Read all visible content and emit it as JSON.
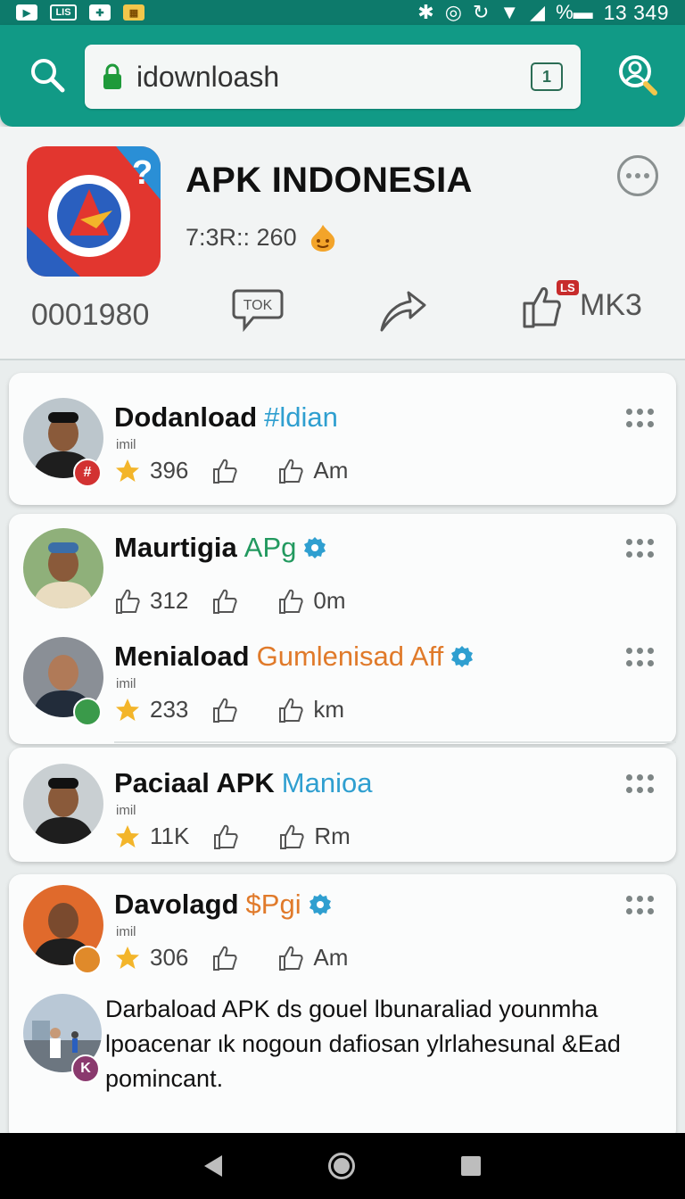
{
  "status_bar": {
    "left_icons": [
      "play-icon",
      "lis-icon",
      "app-icon",
      "store-icon"
    ],
    "lis_label": "LIS",
    "battery_label": "%",
    "time": "13 349"
  },
  "url_bar": {
    "url": "idownloash",
    "tab_count": "1"
  },
  "header": {
    "title": "APK INDONESIA",
    "subtitle": "7:3R:: 260",
    "downloads": "0001980",
    "chat_label": "TOK",
    "like_badge": "LS",
    "like_count": "MK3"
  },
  "items": [
    {
      "name": "Dodanload",
      "accent": "#ldian",
      "accent_color": "#2f9fd0",
      "handle": "imil",
      "first_icon": "star-icon",
      "v1": "396",
      "v2": "Am",
      "badge_color": "#d23232",
      "badge_text": "#"
    },
    {
      "name": "Maurtigia",
      "accent": "APg",
      "accent_color": "#22995f",
      "handle": "",
      "first_icon": "thumbs-up-icon",
      "v1": "312",
      "v2": "0m",
      "verified": true
    },
    {
      "name": "Meniaload",
      "accent": "Gumlenisad Aff",
      "accent_color": "#e07a2a",
      "accent2_color": "#2f7fc0",
      "handle": "imil",
      "first_icon": "star-icon",
      "v1": "233",
      "v2": "km",
      "verified": true,
      "badge_color": "#3a9a4a",
      "badge_text": ""
    },
    {
      "name": "Paciaal APK",
      "accent": "Manioa",
      "accent_color": "#2f9fd0",
      "handle": "imil",
      "first_icon": "star-icon",
      "v1": "11K",
      "v2": "Rm"
    },
    {
      "name": "Davolagd",
      "accent": "$Pgi",
      "accent_color": "#e07a2a",
      "handle": "imil",
      "first_icon": "star-icon",
      "v1": "306",
      "v2": "Am",
      "verified": true,
      "badge_color": "#e08a2a",
      "badge_text": ""
    }
  ],
  "post": {
    "badge_text": "K",
    "text": "Darbaload APK ds gouel lbunaraliad younmha lpoacenar ιk nogoun dafiosan ylrlahesunal &Ead pomincant."
  },
  "colors": {
    "primary": "#119a86",
    "status_bar": "#0d7a6b",
    "verified": "#2f9fd0",
    "star": "#f3b52a"
  }
}
